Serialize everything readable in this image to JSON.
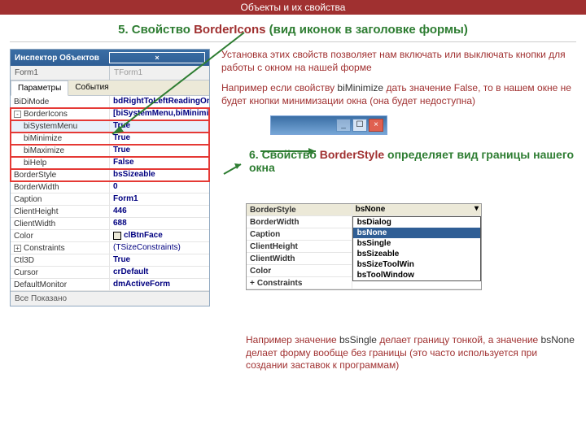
{
  "topBar": "Объекты и их свойства",
  "heading5": {
    "num": "5. Свойство ",
    "prop": "BorderIcons",
    "tail": " (вид иконок в заголовке формы)"
  },
  "para1": {
    "a": "Установка этих свойств позволяет нам включать или выключать кнопки для работы с окном на нашей форме"
  },
  "para2": {
    "a": "Например если свойству ",
    "b": "biMinimize",
    "c": " дать значение False, то в нашем окне не будет кнопки минимизации окна (она будет недоступна)"
  },
  "heading6": {
    "num": "6. Свойство ",
    "prop": "BorderStyle",
    "tail": " определяет вид границы нашего окна"
  },
  "bottomNote": {
    "a": "Например значение ",
    "b": "bsSingle",
    "c": " делает границу тонкой, а значение ",
    "d": "bsNone",
    "e": " делает форму вообще без границы (это часто используется при создании заставок к программам)"
  },
  "inspector": {
    "title": "Инспектор Объектов",
    "closeX": "×",
    "selected": "Form1",
    "className": "TForm1",
    "tabProps": "Параметры",
    "tabEvents": "События",
    "props": [
      {
        "name": "BiDiMode",
        "value": "bdRightToLeftReadingOnly",
        "bold": true
      },
      {
        "name": "BorderIcons",
        "value": "[biSystemMenu,biMinimize,biMaximi:",
        "bold": true,
        "exp": "-",
        "grp": "bi"
      },
      {
        "name": "biSystemMenu",
        "value": "True",
        "bold": true,
        "indent": 1,
        "grp": "bi",
        "sel": true
      },
      {
        "name": "biMinimize",
        "value": "True",
        "bold": true,
        "indent": 1,
        "grp": "bi"
      },
      {
        "name": "biMaximize",
        "value": "True",
        "bold": true,
        "indent": 1,
        "grp": "bi"
      },
      {
        "name": "biHelp",
        "value": "False",
        "bold": true,
        "indent": 1,
        "grp": "bi"
      },
      {
        "name": "BorderStyle",
        "value": "bsSizeable",
        "bold": true,
        "grp": "bs"
      },
      {
        "name": "BorderWidth",
        "value": "0",
        "bold": true
      },
      {
        "name": "Caption",
        "value": "Form1",
        "bold": true
      },
      {
        "name": "ClientHeight",
        "value": "446",
        "bold": true
      },
      {
        "name": "ClientWidth",
        "value": "688",
        "bold": true
      },
      {
        "name": "Color",
        "value": "clBtnFace",
        "bold": true,
        "color": true
      },
      {
        "name": "Constraints",
        "value": "(TSizeConstraints)",
        "bold": false,
        "exp": "+"
      },
      {
        "name": "Ctl3D",
        "value": "True",
        "bold": true
      },
      {
        "name": "Cursor",
        "value": "crDefault",
        "bold": true
      },
      {
        "name": "DefaultMonitor",
        "value": "dmActiveForm",
        "bold": true
      }
    ],
    "footer": "Все Показано"
  },
  "snippet": {
    "rows": [
      {
        "name": "BorderStyle",
        "value": "bsNone",
        "sel": true
      },
      {
        "name": "BorderWidth",
        "value": ""
      },
      {
        "name": "Caption",
        "value": ""
      },
      {
        "name": "ClientHeight",
        "value": ""
      },
      {
        "name": "ClientWidth",
        "value": ""
      },
      {
        "name": "Color",
        "value": ""
      },
      {
        "name": "Constraints",
        "value": "",
        "exp": "+"
      }
    ],
    "dropdown": [
      "bsDialog",
      "bsNone",
      "bsSingle",
      "bsSizeable",
      "bsSizeToolWin",
      "bsToolWindow"
    ],
    "ddSelected": "bsNone"
  }
}
